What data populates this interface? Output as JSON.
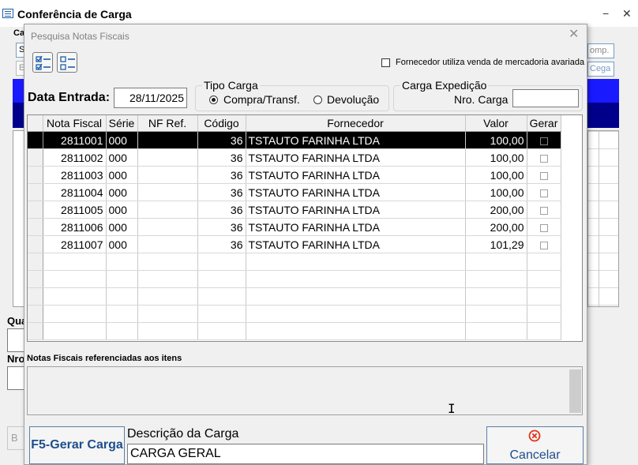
{
  "outer": {
    "title": "Conferência de Carga",
    "min_glyph": "−",
    "close_glyph": "✕",
    "partial_label_1": "Ca",
    "partial_label_2": "S",
    "partial_label_3": "E",
    "partial_comp": "omp.",
    "partial_cega": "Cega",
    "partial_qua": "Qua",
    "partial_nro": "Nro",
    "partial_b": "B",
    "accent_blue": "#1a1aff",
    "accent_navy": "#00008b"
  },
  "dialog": {
    "title": "Pesquisa Notas Fiscais",
    "close_glyph": "✕",
    "check_all_icon": "check-list-icon",
    "uncheck_all_icon": "uncheck-list-icon",
    "avariada_label": "Fornecedor utiliza venda de mercadoria avariada",
    "avariada_checked": false,
    "data_entrada_label": "Data Entrada:",
    "data_entrada_value": "28/11/2025",
    "tipo_carga": {
      "label": "Tipo Carga",
      "option_compra": "Compra/Transf.",
      "option_devolucao": "Devolução",
      "selected": "Compra/Transf."
    },
    "carga_expedicao": {
      "label": "Carga Expedição",
      "nro_label": "Nro. Carga",
      "nro_value": ""
    },
    "grid": {
      "columns": [
        "Nota Fiscal",
        "Série",
        "NF Ref.",
        "Código",
        "Fornecedor",
        "Valor",
        "Gerar"
      ],
      "rows": [
        {
          "nota": "2811001",
          "serie": "000",
          "nfref": "",
          "codigo": "36",
          "fornecedor": "TSTAUTO FARINHA LTDA",
          "valor": "100,00",
          "gerar": false,
          "selected": true
        },
        {
          "nota": "2811002",
          "serie": "000",
          "nfref": "",
          "codigo": "36",
          "fornecedor": "TSTAUTO FARINHA LTDA",
          "valor": "100,00",
          "gerar": false,
          "selected": false
        },
        {
          "nota": "2811003",
          "serie": "000",
          "nfref": "",
          "codigo": "36",
          "fornecedor": "TSTAUTO FARINHA LTDA",
          "valor": "100,00",
          "gerar": false,
          "selected": false
        },
        {
          "nota": "2811004",
          "serie": "000",
          "nfref": "",
          "codigo": "36",
          "fornecedor": "TSTAUTO FARINHA LTDA",
          "valor": "100,00",
          "gerar": false,
          "selected": false
        },
        {
          "nota": "2811005",
          "serie": "000",
          "nfref": "",
          "codigo": "36",
          "fornecedor": "TSTAUTO FARINHA LTDA",
          "valor": "200,00",
          "gerar": false,
          "selected": false
        },
        {
          "nota": "2811006",
          "serie": "000",
          "nfref": "",
          "codigo": "36",
          "fornecedor": "TSTAUTO FARINHA LTDA",
          "valor": "200,00",
          "gerar": false,
          "selected": false
        },
        {
          "nota": "2811007",
          "serie": "000",
          "nfref": "",
          "codigo": "36",
          "fornecedor": "TSTAUTO FARINHA LTDA",
          "valor": "101,29",
          "gerar": false,
          "selected": false
        }
      ]
    },
    "ref_label": "Notas Fiscais referenciadas aos itens",
    "btn_gerar": "F5-Gerar Carga",
    "descricao_label": "Descrição da Carga",
    "descricao_value": "CARGA GERAL",
    "btn_cancelar": "Cancelar",
    "cancel_icon": "cancel-circle-icon",
    "cancel_icon_color": "#e0341b"
  }
}
